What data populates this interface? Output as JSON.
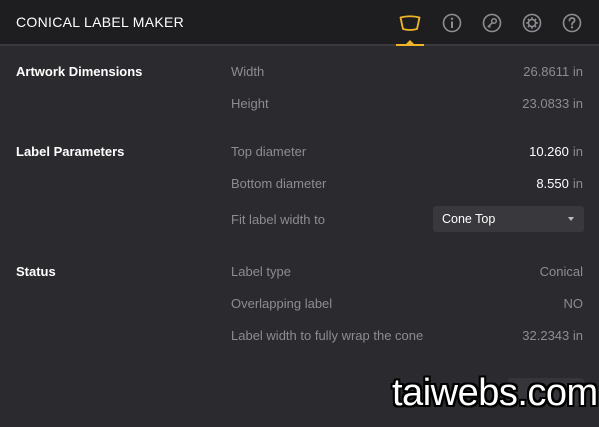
{
  "app": {
    "title": "CONICAL LABEL MAKER"
  },
  "header": {
    "icons": [
      {
        "name": "label-shape-icon",
        "active": true
      },
      {
        "name": "info-icon"
      },
      {
        "name": "key-icon"
      },
      {
        "name": "gear-icon"
      },
      {
        "name": "help-icon"
      }
    ],
    "accent": "#f0b429"
  },
  "artwork": {
    "title": "Artwork Dimensions",
    "width_label": "Width",
    "width_value": "26.8611 in",
    "height_label": "Height",
    "height_value": "23.0833 in"
  },
  "params": {
    "title": "Label Parameters",
    "top_label": "Top diameter",
    "top_value": "10.260",
    "top_unit": "in",
    "bottom_label": "Bottom diameter",
    "bottom_value": "8.550",
    "bottom_unit": "in",
    "fit_label": "Fit label width to",
    "fit_selected": "Cone Top"
  },
  "status": {
    "title": "Status",
    "type_label": "Label type",
    "type_value": "Conical",
    "overlap_label": "Overlapping label",
    "overlap_value": "NO",
    "wrap_label": "Label width to fully wrap the cone",
    "wrap_value": "32.2343 in"
  },
  "watermark": {
    "text": "taiwebs.com"
  }
}
